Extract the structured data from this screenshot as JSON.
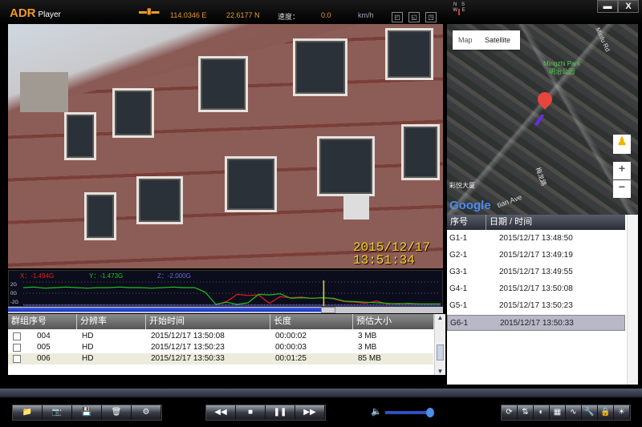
{
  "app": {
    "title_main": "ADR",
    "title_sub": "Player",
    "minimize": "▬",
    "close": "X"
  },
  "gps": {
    "longitude": "114.0346 E",
    "latitude": "22.6177 N",
    "speed_label": "速度：",
    "speed": "0.0",
    "speed_unit": "km/h",
    "compass": "N S W E"
  },
  "video": {
    "date": "2015/12/17",
    "time": "13:51:34"
  },
  "gsensor": {
    "x_label": "X：-1.494G",
    "y_label": "Y：-1.473G",
    "z_label": "Z：-2.000G",
    "axis_ticks": [
      "2G",
      "0G",
      "-2G"
    ],
    "colors": {
      "x": "#e02020",
      "y": "#20c020",
      "z": "#6060d0",
      "cursor": "#e8e020"
    },
    "y_series": [
      1,
      1.1,
      0.9,
      1,
      1.1,
      1,
      0.9,
      1,
      1,
      1.1,
      1,
      1,
      0.9,
      1,
      1.1,
      1,
      1,
      0.2,
      -2,
      -1.6,
      -2,
      -1.7,
      -0.2,
      -0.3,
      -0.1,
      -0.9,
      -0.8,
      -0.9,
      -0.8,
      -0.9,
      -1.4,
      -1.5,
      -1.6,
      -1.7,
      -1.8,
      -1.9,
      -1.8,
      -1.9,
      -1.9,
      -1.9
    ],
    "x_series": [
      null,
      null,
      null,
      null,
      null,
      null,
      null,
      null,
      null,
      null,
      null,
      null,
      null,
      null,
      null,
      null,
      null,
      null,
      -2,
      -1.5,
      -0.2,
      -0.4,
      -0.3,
      -1.8,
      -0.6,
      -0.8,
      -0.7,
      -0.9,
      -0.8,
      -1,
      -1.5,
      -1.6,
      -1.8,
      -1.4,
      -1.9,
      -1.8,
      -1.9,
      -1.9,
      -1.9,
      -1.9
    ],
    "cursor_fraction": 0.72,
    "progress_fraction": 0.72
  },
  "table": {
    "headers": [
      "群组序号",
      "分辨率",
      "开始时间",
      "长度",
      "预估大小"
    ],
    "rows": [
      [
        "004",
        "HD",
        "2015/12/17 13:50:08",
        "00:00:02",
        "3 MB"
      ],
      [
        "005",
        "HD",
        "2015/12/17 13:50:23",
        "00:00:03",
        "3 MB"
      ],
      [
        "006",
        "HD",
        "2015/12/17 13:50:33",
        "00:01:25",
        "85 MB"
      ]
    ],
    "selected_row": 2
  },
  "map": {
    "tab_map": "Map",
    "tab_satellite": "Satellite",
    "park_en": "Mingzhi Park",
    "park_cn": "明治公园",
    "road1": "Minfu Rd",
    "road2": "梅龙路",
    "road3": "tian Ave",
    "place": "彩悦大厦",
    "brand": "Google",
    "zoom_in": "+",
    "zoom_out": "−"
  },
  "events": {
    "headers": [
      "序号",
      "日期 / 时间"
    ],
    "selected": 5,
    "items": [
      {
        "id": "G1-1",
        "dt": "2015/12/17  13:48:50"
      },
      {
        "id": "G2-1",
        "dt": "2015/12/17  13:49:19"
      },
      {
        "id": "G3-1",
        "dt": "2015/12/17  13:49:55"
      },
      {
        "id": "G4-1",
        "dt": "2015/12/17  13:50:08"
      },
      {
        "id": "G5-1",
        "dt": "2015/12/17  13:50:23"
      },
      {
        "id": "G6-1",
        "dt": "2015/12/17  13:50:33"
      }
    ]
  },
  "controls": {
    "file": [
      "folder-icon",
      "camera-icon",
      "save-icon",
      "trash-icon",
      "gear-icon"
    ],
    "playback": [
      "◀◀",
      "■",
      "❚❚",
      "▶▶"
    ],
    "volume_fraction": 1.0,
    "tools": [
      "rotate-icon",
      "flip-icon",
      "google-earth-icon",
      "map-icon",
      "wave-icon",
      "wrench-icon",
      "lock-icon",
      "brightness-icon"
    ]
  }
}
